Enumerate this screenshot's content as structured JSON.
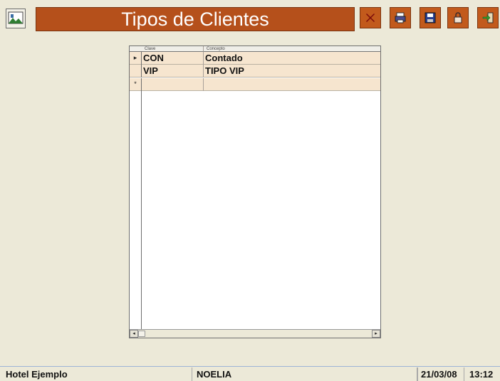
{
  "header": {
    "title": "Tipos de Clientes"
  },
  "toolbar": {
    "buttons": [
      "delete-icon",
      "print-icon",
      "save-icon",
      "lock-icon",
      "exit-icon"
    ]
  },
  "grid": {
    "columns": [
      "Clave",
      "Concepto"
    ],
    "rows": [
      {
        "indicator": "▸",
        "clave": "CON",
        "concepto": "Contado"
      },
      {
        "indicator": "",
        "clave": "VIP",
        "concepto": "TIPO VIP"
      }
    ],
    "new_row_indicator": "*"
  },
  "status": {
    "hotel": "Hotel Ejemplo",
    "user": "NOELIA",
    "date": "21/03/08",
    "time": "13:12"
  },
  "colors": {
    "title_bg": "#b5501b",
    "row_bg": "#f6e5cf",
    "window_bg": "#ece9d8"
  }
}
